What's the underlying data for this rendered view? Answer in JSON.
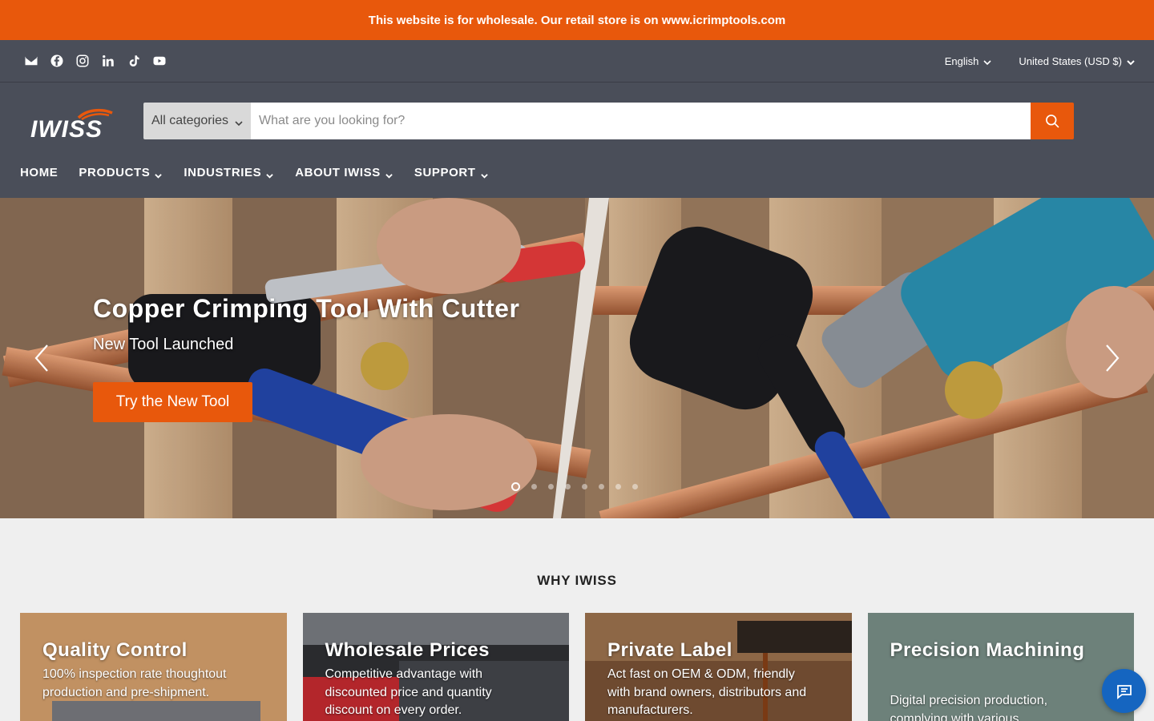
{
  "announcement": "This website is for wholesale. Our retail store is on www.icrimptools.com",
  "social": [
    "email-icon",
    "facebook-icon",
    "instagram-icon",
    "linkedin-icon",
    "tiktok-icon",
    "youtube-icon"
  ],
  "locale": {
    "language": "English",
    "currency": "United States (USD $)"
  },
  "brand": {
    "logo_text": "IWISS",
    "accent": "#e8580c",
    "header_bg": "#4a4e59"
  },
  "search": {
    "category": "All categories",
    "placeholder": "What are you looking for?"
  },
  "nav": [
    {
      "label": "HOME",
      "has_dropdown": false
    },
    {
      "label": "PRODUCTS",
      "has_dropdown": true
    },
    {
      "label": "INDUSTRIES",
      "has_dropdown": true
    },
    {
      "label": "ABOUT IWISS",
      "has_dropdown": true
    },
    {
      "label": "SUPPORT",
      "has_dropdown": true
    }
  ],
  "hero": {
    "title": "Copper Crimping Tool With Cutter",
    "subtitle": "New Tool Launched",
    "button": "Try the New Tool",
    "slide_count": 8,
    "active_slide": 1
  },
  "why": {
    "heading": "WHY IWISS",
    "cards": [
      {
        "title": "Quality Control",
        "text": "100% inspection rate thoughtout production and pre-shipment."
      },
      {
        "title": "Wholesale Prices",
        "text": "Competitive advantage with discounted price and quantity discount on every order."
      },
      {
        "title": "Private Label",
        "text": "Act fast on OEM & ODM, friendly with brand owners, distributors and manufacturers."
      },
      {
        "title": "Precision Machining",
        "text": "Digital precision production, complying with various"
      }
    ]
  }
}
